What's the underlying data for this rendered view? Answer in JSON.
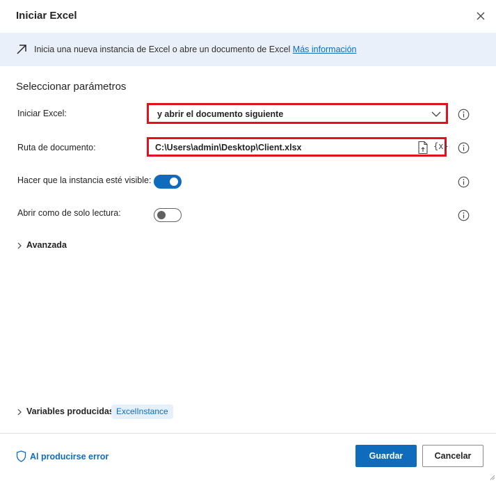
{
  "dialog": {
    "title": "Iniciar Excel",
    "close_icon": "close-icon"
  },
  "banner": {
    "icon": "arrow-up-right-icon",
    "text": "Inicia una nueva instancia de Excel o abre un documento de Excel",
    "link": "Más información"
  },
  "params": {
    "section_title": "Seleccionar parámetros",
    "launch_excel": {
      "label": "Iniciar Excel:",
      "value": "y abrir el documento siguiente"
    },
    "document_path": {
      "label": "Ruta de documento:",
      "value": "C:\\Users\\admin\\Desktop\\Client.xlsx",
      "var_symbol": "{x}"
    },
    "visible_instance": {
      "label": "Hacer que la instancia esté visible:",
      "state": "on"
    },
    "read_only": {
      "label": "Abrir como de solo lectura:",
      "state": "off"
    },
    "advanced": {
      "label": "Avanzada"
    }
  },
  "variables": {
    "label": "Variables producidas",
    "chip": "ExcelInstance"
  },
  "footer": {
    "error_link": "Al producirse error",
    "save_label": "Guardar",
    "cancel_label": "Cancelar"
  },
  "colors": {
    "accent": "#0f6cbd",
    "highlight_border": "#e3101e",
    "banner_bg": "#e9f0fa"
  }
}
